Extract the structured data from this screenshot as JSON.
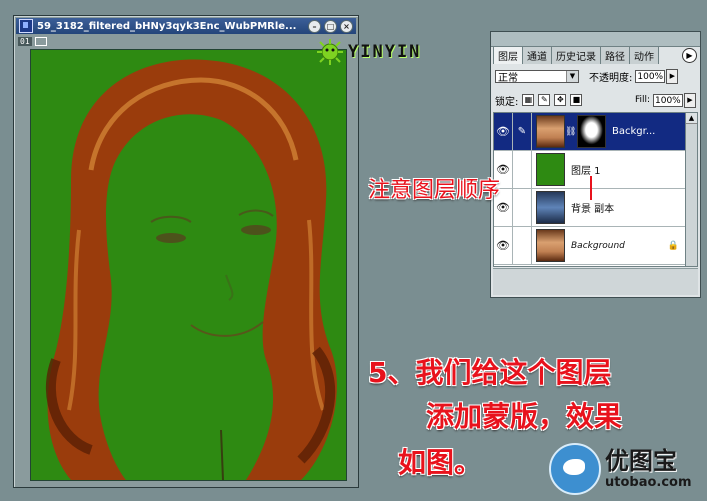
{
  "document": {
    "title": "59_3182_filtered_bHNy3qyk3Enc_WubPMRle...",
    "sub_tag": "01",
    "controls": {
      "minimize": "–",
      "maximize": "□",
      "close": "×"
    }
  },
  "watermark": {
    "text": "YINYIN"
  },
  "layers_panel": {
    "tabs": [
      {
        "label": "图层"
      },
      {
        "label": "通道"
      },
      {
        "label": "历史记录"
      },
      {
        "label": "路径"
      },
      {
        "label": "动作"
      }
    ],
    "blend_mode": "正常",
    "opacity_label": "不透明度:",
    "opacity_value": "100%",
    "lock_label": "锁定:",
    "fill_label": "Fill:",
    "fill_value": "100%",
    "layers": [
      {
        "name": "Backgr...",
        "selected": true
      },
      {
        "name": "图层 1",
        "selected": false
      },
      {
        "name": "背景 副本",
        "selected": false
      },
      {
        "name": "Background",
        "selected": false
      }
    ]
  },
  "annotations": {
    "layer_order_note": "注意图层顺序",
    "step_line1": "5、我们给这个图层",
    "step_line2": "添加蒙版，效果",
    "step_line3": "如图。"
  },
  "logo": {
    "cn": "优图宝",
    "en": "utobao.com"
  },
  "colors": {
    "canvas_green": "#2e8a12",
    "hair": "#9a3c0c",
    "annotation_red": "#e8121c",
    "selected_layer": "#122a82"
  }
}
